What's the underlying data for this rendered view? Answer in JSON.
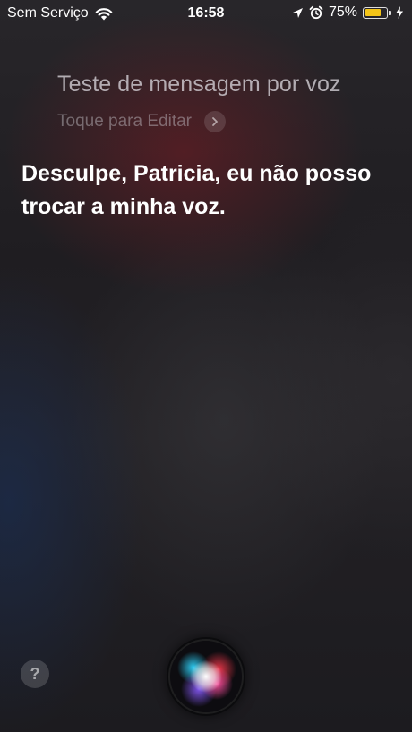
{
  "status_bar": {
    "carrier": "Sem Serviço",
    "time": "16:58",
    "battery_percent": "75%",
    "battery_level": 0.75,
    "battery_color": "#f5c518",
    "icons": [
      "wifi-icon",
      "location-arrow-icon",
      "alarm-clock-icon",
      "battery-icon",
      "charging-bolt-icon"
    ]
  },
  "siri": {
    "query_text": "Teste de mensagem por voz",
    "edit_label": "Toque para Editar",
    "response_text": "Desculpe, Patricia, eu não posso trocar a minha voz.",
    "help_label": "?"
  }
}
